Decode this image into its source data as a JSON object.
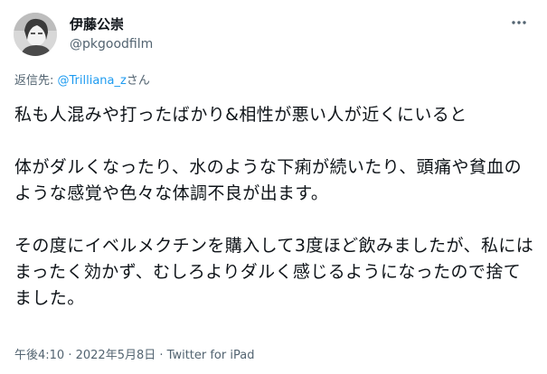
{
  "author": {
    "display_name": "伊藤公崇",
    "handle": "@pkgoodfilm"
  },
  "reply": {
    "prefix": "返信先: ",
    "mention": "@Trilliana_z",
    "suffix": "さん"
  },
  "tweet": {
    "paragraphs": [
      "私も人混みや打ったばかり&相性が悪い人が近くにいると",
      "体がダルくなったり、水のような下痢が続いたり、頭痛や貧血のような感覚や色々な体調不良が出ます。",
      "その度にイベルメクチンを購入して3度ほど飲みましたが、私にはまったく効かず、むしろよりダルく感じるようになったので捨てました。"
    ],
    "time": "午後4:10",
    "separator": " · ",
    "date": "2022年5月8日",
    "source": "Twitter for iPad"
  },
  "icons": {
    "more": "more-horizontal-icon",
    "avatar": "avatar-image"
  },
  "colors": {
    "text": "#0f1419",
    "secondary": "#536471",
    "link": "#1d9bf0"
  }
}
